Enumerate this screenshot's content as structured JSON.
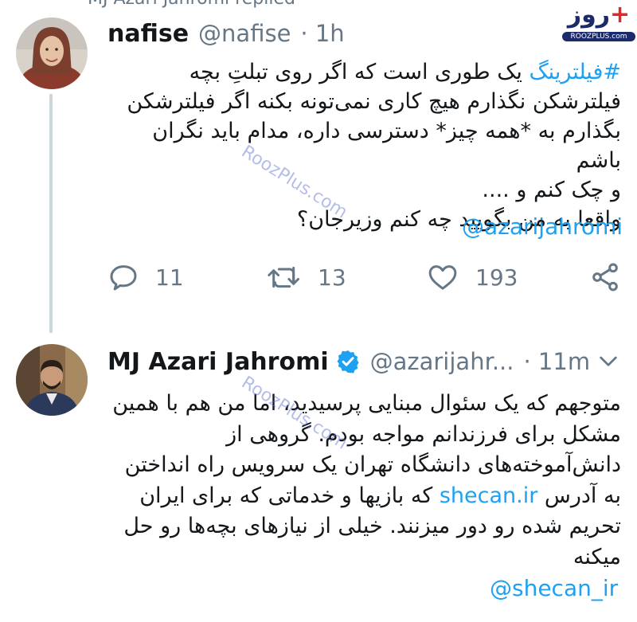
{
  "top_bar": {
    "reply_text": "MJ Azari Jahromi replied"
  },
  "watermark": {
    "logo_text": "روز",
    "logo_plus": "+",
    "logo_url": "ROOZPLUS.com",
    "diagonal_text": "RoozPlus.com"
  },
  "tweet1": {
    "name": "nafise",
    "handle": "@nafise",
    "time": "· 1h",
    "hashtag": "#فیلترینگ",
    "lines": [
      " یک طوری است که اگر روی تبلتِ بچه",
      "فیلترشکن نگذارم هیچ کاری نمی‌تونه بکنه اگر فیلترشکن",
      "بگذارم به *همه چیز* دسترسی داره، مدام باید نگران باشم",
      "و چک کنم و ....",
      "واقعا به من بگویید چه کنم وزیرجان؟"
    ],
    "mention": "@azarijahromi",
    "replies": "11",
    "retweets": "13",
    "likes": "193"
  },
  "tweet2": {
    "name": "MJ Azari Jahromi",
    "handle": "@azarijahr...",
    "time": "· 11m",
    "lines": [
      "متوجهم که یک سئوال مبنایی پرسیدید، اما من هم با همین",
      "مشکل برای فرزندانم مواجه بودم. گروهی از",
      "دانش‌آموخته‌های دانشگاه تهران یک سرویس راه انداختن"
    ],
    "line4_prefix": "به آدرس ",
    "link": "shecan.ir",
    "line4_suffix": " که بازیها و خدماتی که برای ایران",
    "lines_after": [
      "تحریم شده رو دور میزنند. خیلی از نیازهای بچه‌ها رو حل",
      "میکنه"
    ],
    "mention": "@shecan_ir"
  },
  "colors": {
    "link": "#1da1f2",
    "meta": "#657786",
    "verified": "#1da1f2"
  }
}
